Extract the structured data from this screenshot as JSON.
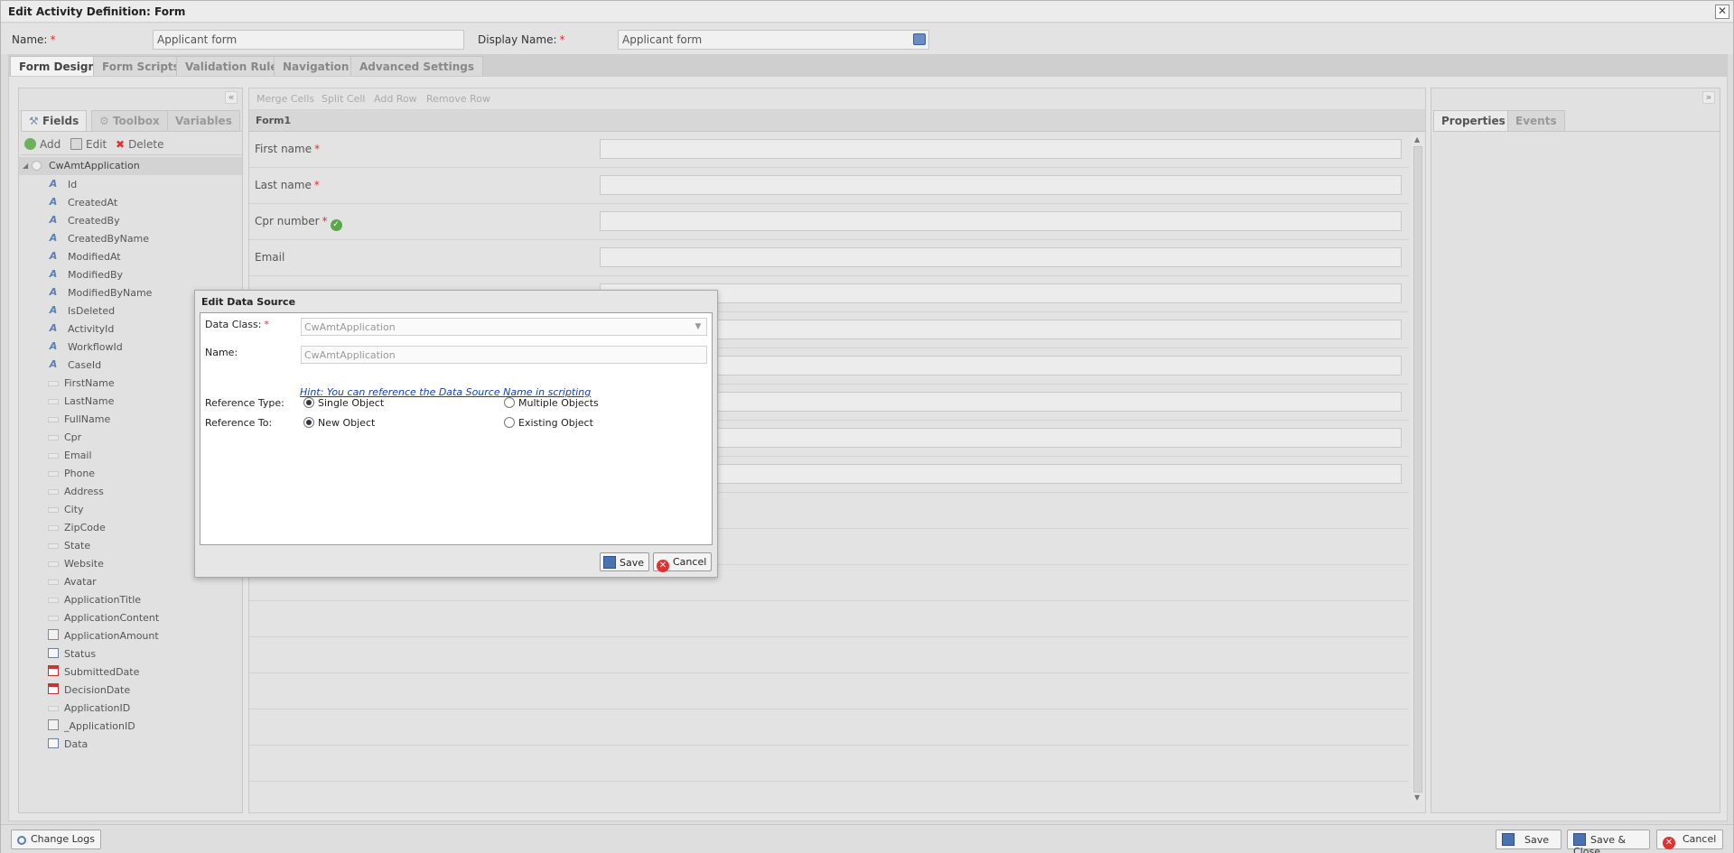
{
  "window": {
    "title": "Edit Activity Definition: Form",
    "close_glyph": "✕"
  },
  "header": {
    "name_label": "Name:",
    "name_value": "Applicant form",
    "display_label": "Display Name:",
    "display_value": "Applicant form",
    "required_mark": "*"
  },
  "tabs": [
    "Form Design",
    "Form Scripts",
    "Validation Rules",
    "Navigation",
    "Advanced Settings"
  ],
  "left_panel": {
    "collapse_glyph": "«",
    "tabs": [
      "Fields",
      "Toolbox",
      "Variables"
    ],
    "toolbar": {
      "add": "Add",
      "edit": "Edit",
      "delete": "Delete"
    },
    "root": "CwAmtApplication",
    "fields": [
      {
        "label": "Id",
        "icon": "text-icon"
      },
      {
        "label": "CreatedAt",
        "icon": "text-icon"
      },
      {
        "label": "CreatedBy",
        "icon": "text-icon"
      },
      {
        "label": "CreatedByName",
        "icon": "text-icon"
      },
      {
        "label": "ModifiedAt",
        "icon": "text-icon"
      },
      {
        "label": "ModifiedBy",
        "icon": "text-icon"
      },
      {
        "label": "ModifiedByName",
        "icon": "text-icon"
      },
      {
        "label": "IsDeleted",
        "icon": "text-icon"
      },
      {
        "label": "ActivityId",
        "icon": "text-icon"
      },
      {
        "label": "WorkflowId",
        "icon": "text-icon"
      },
      {
        "label": "CaseId",
        "icon": "text-icon"
      },
      {
        "label": "FirstName",
        "icon": "textbox-icon"
      },
      {
        "label": "LastName",
        "icon": "textbox-icon"
      },
      {
        "label": "FullName",
        "icon": "textbox-icon"
      },
      {
        "label": "Cpr",
        "icon": "textbox-icon"
      },
      {
        "label": "Email",
        "icon": "textbox-icon"
      },
      {
        "label": "Phone",
        "icon": "textbox-icon"
      },
      {
        "label": "Address",
        "icon": "textbox-icon"
      },
      {
        "label": "City",
        "icon": "textbox-icon"
      },
      {
        "label": "ZipCode",
        "icon": "textbox-icon"
      },
      {
        "label": "State",
        "icon": "textbox-icon"
      },
      {
        "label": "Website",
        "icon": "textbox-icon"
      },
      {
        "label": "Avatar",
        "icon": "textbox-icon"
      },
      {
        "label": "ApplicationTitle",
        "icon": "textbox-icon"
      },
      {
        "label": "ApplicationContent",
        "icon": "textbox-icon"
      },
      {
        "label": "ApplicationAmount",
        "icon": "calculator-icon"
      },
      {
        "label": "Status",
        "icon": "list-icon"
      },
      {
        "label": "SubmittedDate",
        "icon": "calendar-icon"
      },
      {
        "label": "DecisionDate",
        "icon": "calendar-icon"
      },
      {
        "label": "ApplicationID",
        "icon": "textbox-icon"
      },
      {
        "label": "_ApplicationID",
        "icon": "calculator-icon"
      },
      {
        "label": "Data",
        "icon": "list-icon"
      }
    ]
  },
  "designer": {
    "toolbar": [
      "Merge Cells",
      "Split Cell",
      "Add Row",
      "Remove Row"
    ],
    "form_title": "Form1",
    "rows": [
      "First name",
      "Last name",
      "Cpr number",
      "Email",
      "",
      "",
      "",
      "",
      "",
      "",
      "",
      "",
      "",
      "",
      "",
      "",
      "",
      ""
    ],
    "required_rows": [
      0,
      1,
      2
    ],
    "verified_row": 2
  },
  "right_panel": {
    "expand_glyph": "»",
    "tabs": [
      "Properties",
      "Events"
    ]
  },
  "dialog": {
    "title": "Edit Data Source",
    "data_class_label": "Data Class:",
    "data_class_value": "CwAmtApplication",
    "name_label": "Name:",
    "name_value": "CwAmtApplication",
    "hint": "Hint: You can reference the Data Source Name in scripting",
    "reference_type_label": "Reference Type:",
    "reference_type_options": [
      "Single Object",
      "Multiple Objects"
    ],
    "reference_type_selected": "Single Object",
    "reference_to_label": "Reference To:",
    "reference_to_options": [
      "New Object",
      "Existing Object"
    ],
    "reference_to_selected": "New Object",
    "save": "Save",
    "cancel": "Cancel"
  },
  "bottom": {
    "change_logs": "Change Logs",
    "save": "Save",
    "save_close": "Save & Close",
    "cancel": "Cancel"
  }
}
